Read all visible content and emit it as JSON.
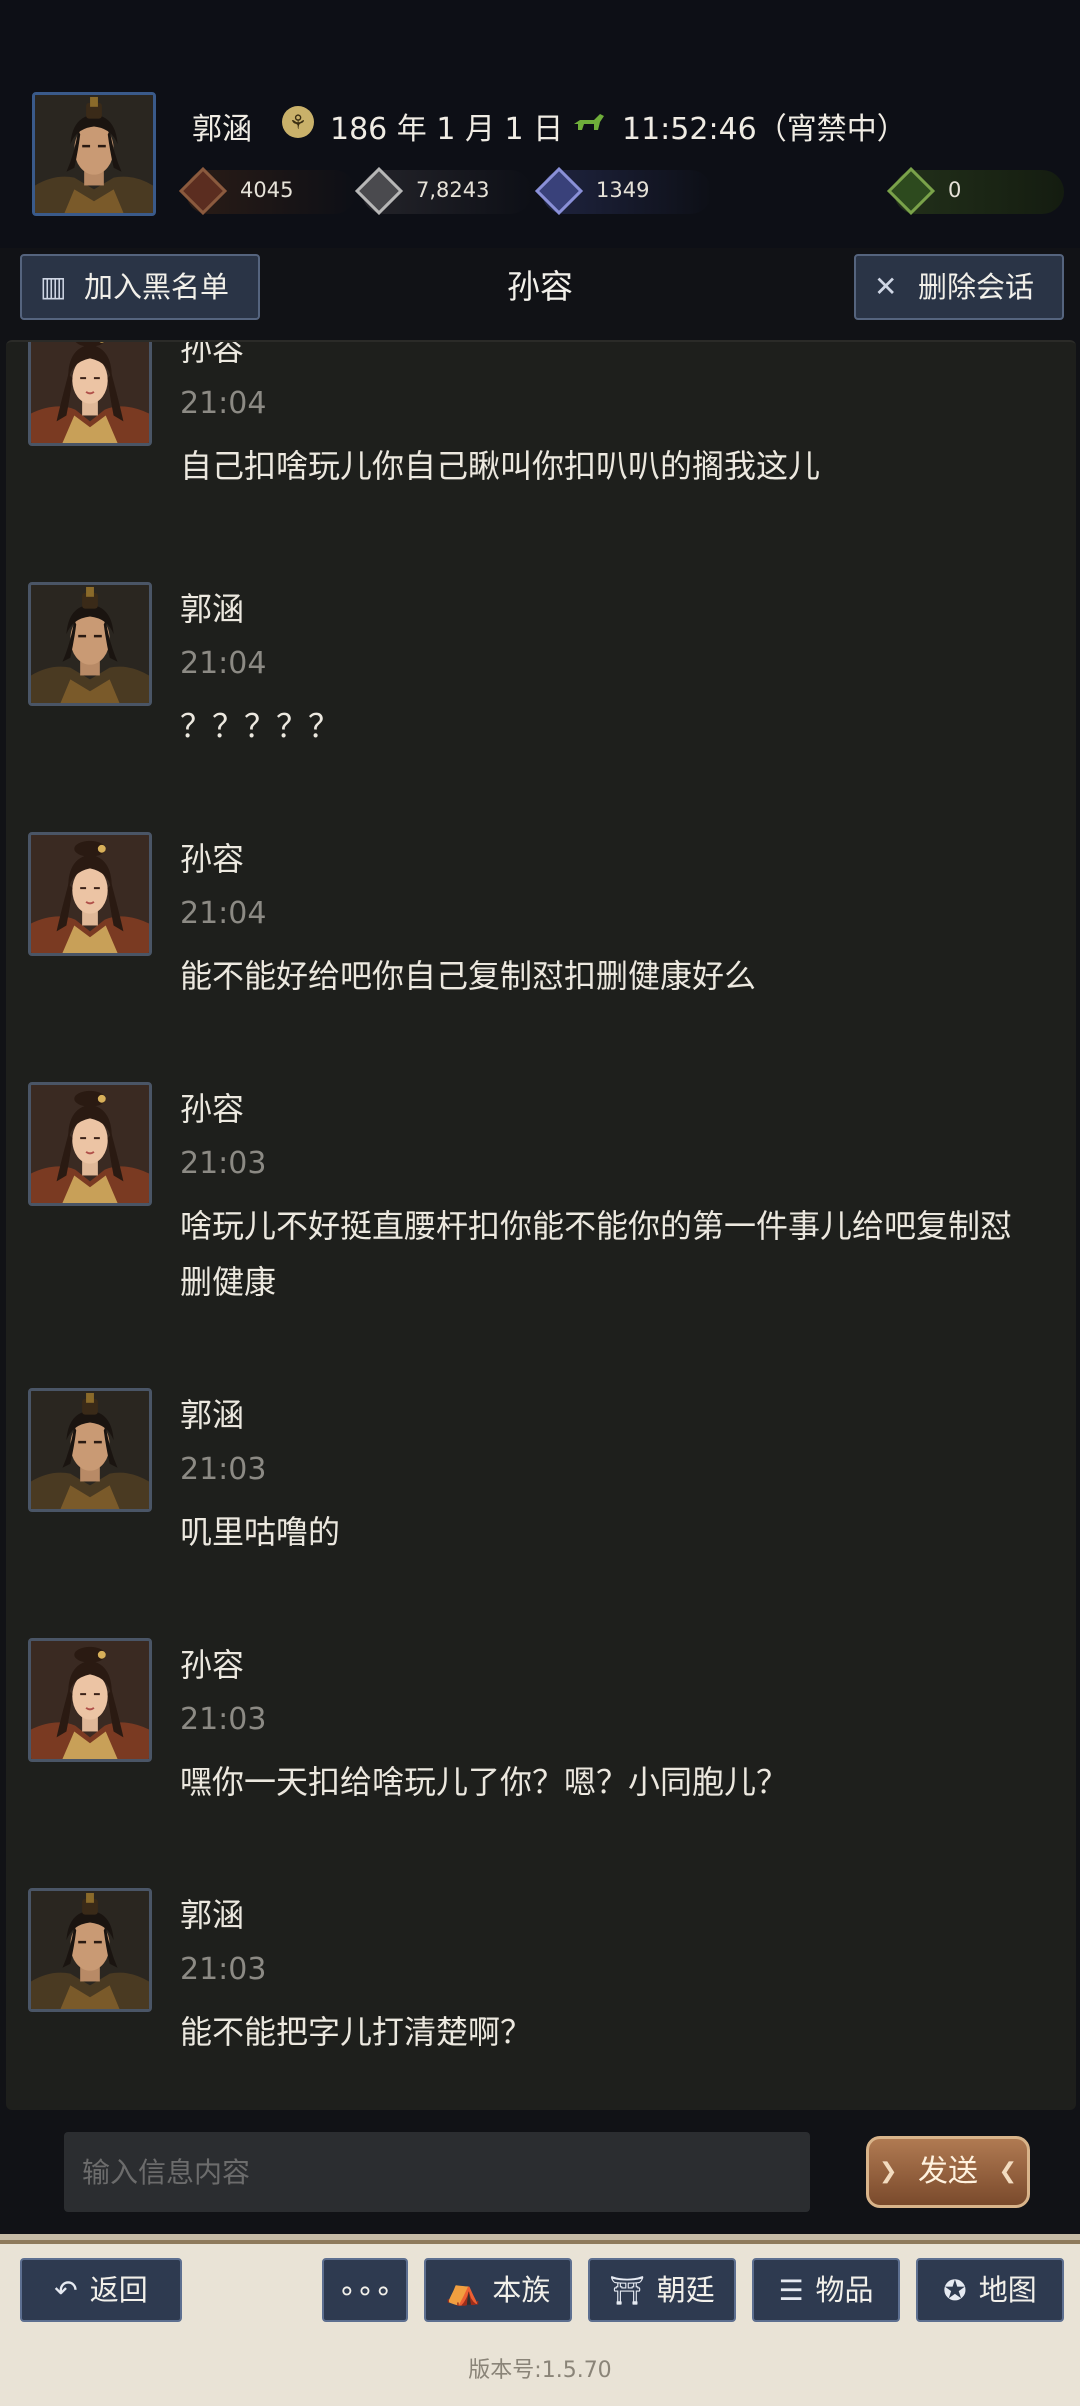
{
  "header": {
    "player_name": "郭涵",
    "date_icon": "horse-seal-icon",
    "date": "186 年 1 月 1 日",
    "time_icon": "horse-icon",
    "time": "11:52:46（宵禁中）",
    "resources": [
      {
        "icon": "coins-icon",
        "value": "4045"
      },
      {
        "icon": "grain-icon",
        "value": "7,8243"
      },
      {
        "icon": "soldier-icon",
        "value": "1349"
      },
      {
        "icon": "pouch-icon",
        "value": "0"
      }
    ]
  },
  "toolbar": {
    "blacklist_label": "加入黑名单",
    "title": "孙容",
    "delete_label": "删除会话"
  },
  "messages": [
    {
      "sender": "孙容",
      "time": "21:04",
      "text": "自己扣啥玩儿你自己瞅叫你扣叭叭的搁我这儿",
      "avatar": "female"
    },
    {
      "sender": "郭涵",
      "time": "21:04",
      "text": "？？？？？",
      "avatar": "male"
    },
    {
      "sender": "孙容",
      "time": "21:04",
      "text": "能不能好给吧你自己复制怼扣删健康好么",
      "avatar": "female"
    },
    {
      "sender": "孙容",
      "time": "21:03",
      "text": "啥玩儿不好挺直腰杆扣你能不能你的第一件事儿给吧复制怼删健康",
      "avatar": "female"
    },
    {
      "sender": "郭涵",
      "time": "21:03",
      "text": "叽里咕噜的",
      "avatar": "male"
    },
    {
      "sender": "孙容",
      "time": "21:03",
      "text": "嘿你一天扣给啥玩儿了你？嗯？小同胞儿？",
      "avatar": "female"
    },
    {
      "sender": "郭涵",
      "time": "21:03",
      "text": "能不能把字儿打清楚啊？",
      "avatar": "male"
    }
  ],
  "composer": {
    "placeholder": "输入信息内容",
    "send_label": "发送"
  },
  "nav": {
    "back": "返回",
    "more": "∘∘∘",
    "clan": "本族",
    "court": "朝廷",
    "items": "物品",
    "map": "地图"
  },
  "version": "版本号:1.5.70",
  "colors": {
    "background": "#111216",
    "chat_panel": "#1e1f1c",
    "button_blue": "#2a3446",
    "send_bronze": "#9a6640",
    "nav_bar": "#e9e3d6"
  }
}
